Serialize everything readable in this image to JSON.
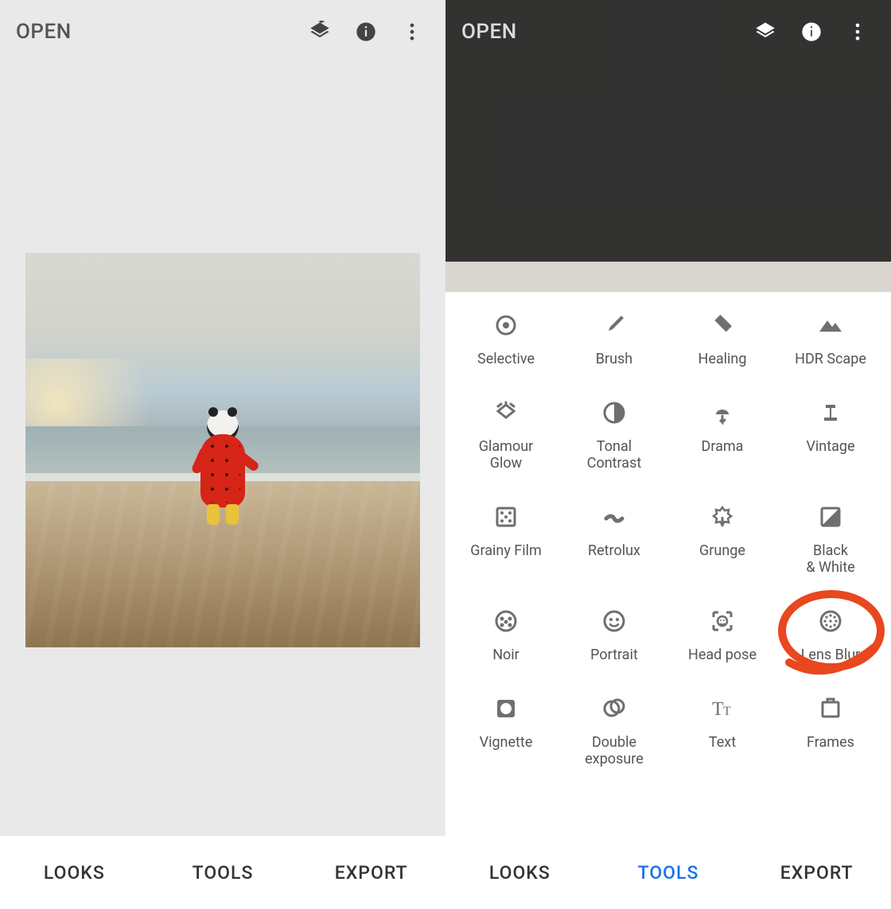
{
  "colors": {
    "accent": "#1a73e8",
    "annotation": "#e8471f"
  },
  "left": {
    "open": "OPEN",
    "tabs": {
      "looks": "LOOKS",
      "tools": "TOOLS",
      "export": "EXPORT"
    },
    "circled_tab": "tools"
  },
  "right": {
    "open": "OPEN",
    "tabs": {
      "looks": "LOOKS",
      "tools": "TOOLS",
      "export": "EXPORT",
      "active": "tools"
    },
    "circled_tool": "lens-blur",
    "tools": [
      {
        "id": "selective",
        "label": "Selective",
        "icon": "selective"
      },
      {
        "id": "brush",
        "label": "Brush",
        "icon": "brush"
      },
      {
        "id": "healing",
        "label": "Healing",
        "icon": "healing"
      },
      {
        "id": "hdr-scape",
        "label": "HDR Scape",
        "icon": "hdr"
      },
      {
        "id": "glamour-glow",
        "label": "Glamour\nGlow",
        "icon": "glamour"
      },
      {
        "id": "tonal-contrast",
        "label": "Tonal\nContrast",
        "icon": "tonal"
      },
      {
        "id": "drama",
        "label": "Drama",
        "icon": "drama"
      },
      {
        "id": "vintage",
        "label": "Vintage",
        "icon": "vintage"
      },
      {
        "id": "grainy-film",
        "label": "Grainy Film",
        "icon": "grainy"
      },
      {
        "id": "retrolux",
        "label": "Retrolux",
        "icon": "retrolux"
      },
      {
        "id": "grunge",
        "label": "Grunge",
        "icon": "grunge"
      },
      {
        "id": "black-white",
        "label": "Black\n& White",
        "icon": "bw"
      },
      {
        "id": "noir",
        "label": "Noir",
        "icon": "noir"
      },
      {
        "id": "portrait",
        "label": "Portrait",
        "icon": "portrait"
      },
      {
        "id": "head-pose",
        "label": "Head pose",
        "icon": "headpose"
      },
      {
        "id": "lens-blur",
        "label": "Lens Blur",
        "icon": "lensblur"
      },
      {
        "id": "vignette",
        "label": "Vignette",
        "icon": "vignette"
      },
      {
        "id": "double-exposure",
        "label": "Double\nexposure",
        "icon": "double"
      },
      {
        "id": "text",
        "label": "Text",
        "icon": "text"
      },
      {
        "id": "frames",
        "label": "Frames",
        "icon": "frames"
      }
    ]
  }
}
